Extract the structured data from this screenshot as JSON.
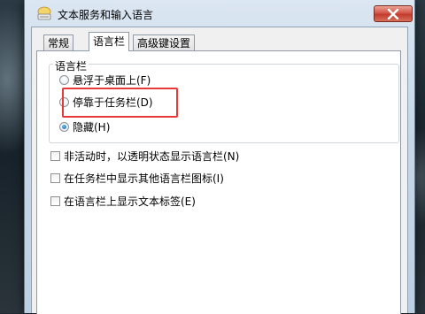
{
  "window": {
    "title": "文本服务和输入语言"
  },
  "tabs": [
    {
      "label": "常规",
      "active": false
    },
    {
      "label": "语言栏",
      "active": true
    },
    {
      "label": "高级键设置",
      "active": false
    }
  ],
  "language_bar_group": {
    "legend": "语言栏",
    "options": [
      {
        "label": "悬浮于桌面上(F)",
        "checked": false
      },
      {
        "label": "停靠于任务栏(D)",
        "checked": false
      },
      {
        "label": "隐藏(H)",
        "checked": true
      }
    ]
  },
  "checkboxes": [
    {
      "label": "非活动时，以透明状态显示语言栏(N)",
      "checked": false
    },
    {
      "label": "在任务栏中显示其他语言栏图标(I)",
      "checked": false
    },
    {
      "label": "在语言栏上显示文本标签(E)",
      "checked": false
    }
  ],
  "colors": {
    "highlight": "#e8393a",
    "close_button": "#c8473a"
  },
  "icons": {
    "app": "keyboard-icon",
    "close": "close-icon"
  }
}
